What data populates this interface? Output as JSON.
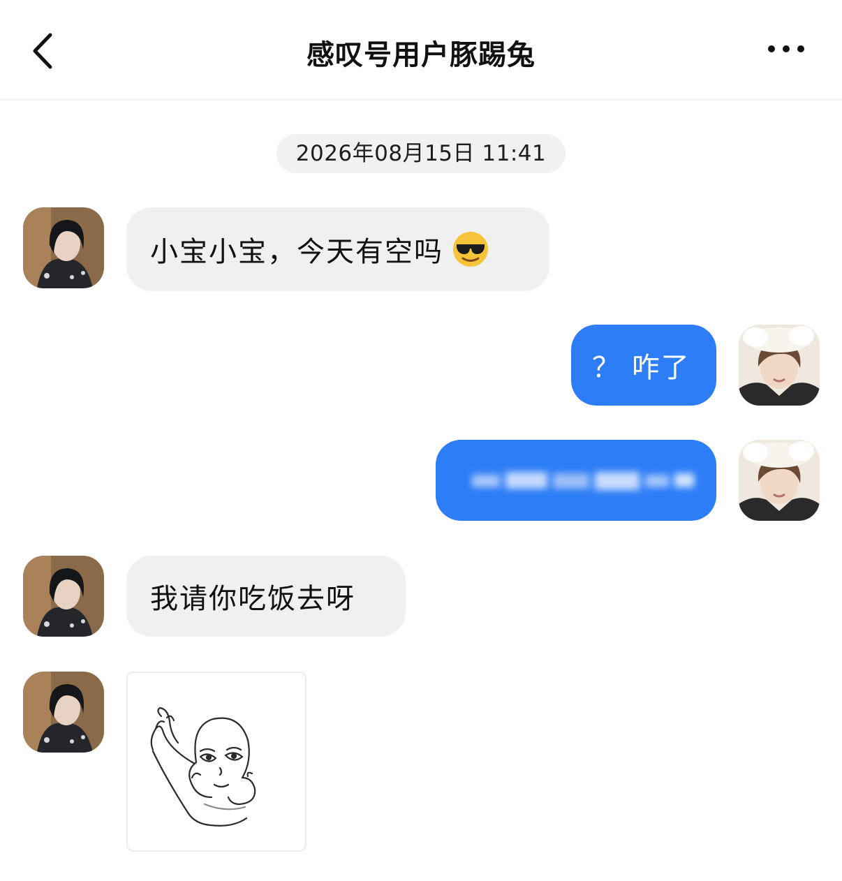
{
  "header": {
    "title": "感叹号用户豚踢兔",
    "back_icon": "chevron-left-icon",
    "more_icon": "more-horizontal-icon"
  },
  "timestamp": "2026年08月15日 11:41",
  "messages": [
    {
      "from": "other",
      "text": "小宝小宝，今天有空吗",
      "emoji": "smiling-face-with-sunglasses"
    },
    {
      "from": "me",
      "text": "？ 咋了"
    },
    {
      "from": "me",
      "text": "",
      "blurred": true
    },
    {
      "from": "other",
      "text": "我请你吃饭去呀"
    },
    {
      "from": "other",
      "type": "sticker",
      "sticker": "doodle-face-lying-sticker"
    }
  ],
  "colors": {
    "outgoing_bubble": "#2d7df6",
    "incoming_bubble": "#f0f0f1",
    "timestamp_bg": "#f1f1f2"
  }
}
